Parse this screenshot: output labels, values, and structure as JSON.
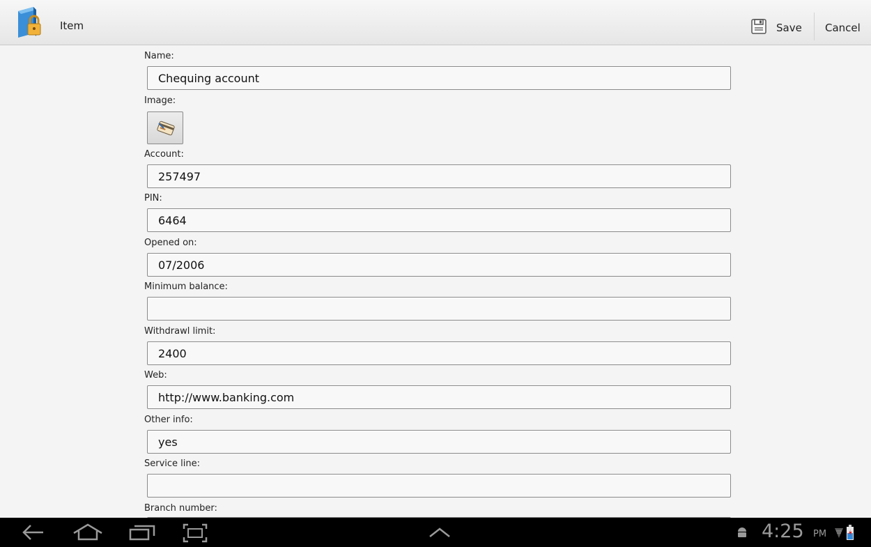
{
  "action_bar": {
    "title": "Item",
    "save_label": "Save",
    "cancel_label": "Cancel"
  },
  "form": {
    "name_label": "Name:",
    "name_value": "Chequing account",
    "image_label": "Image:",
    "account_label": "Account:",
    "account_value": "257497",
    "pin_label": "PIN:",
    "pin_value": "6464",
    "opened_label": "Opened on:",
    "opened_value": "07/2006",
    "min_balance_label": "Minimum balance:",
    "min_balance_value": "",
    "withdrawal_label": "Withdrawl limit:",
    "withdrawal_value": "2400",
    "web_label": "Web:",
    "web_value": "http://www.banking.com",
    "other_label": "Other info:",
    "other_value": "yes",
    "service_label": "Service line:",
    "service_value": "",
    "branch_label": "Branch number:"
  },
  "status_bar": {
    "time": "4:25",
    "ampm": "PM"
  },
  "icons": {
    "app": "lock-book-icon",
    "save": "floppy-disk-icon",
    "image": "credit-card-icon",
    "nav_back": "back-arrow-icon",
    "nav_home": "home-icon",
    "nav_recent": "recent-apps-icon",
    "nav_screenshot": "screenshot-icon",
    "nav_up": "chevron-up-icon",
    "android": "android-icon",
    "signal": "signal-icon",
    "battery": "battery-icon"
  },
  "colors": {
    "action_bar": "#ececec",
    "background": "#f4f4f4",
    "nav_bar": "#000000",
    "nav_icon": "#9a9a9a"
  }
}
